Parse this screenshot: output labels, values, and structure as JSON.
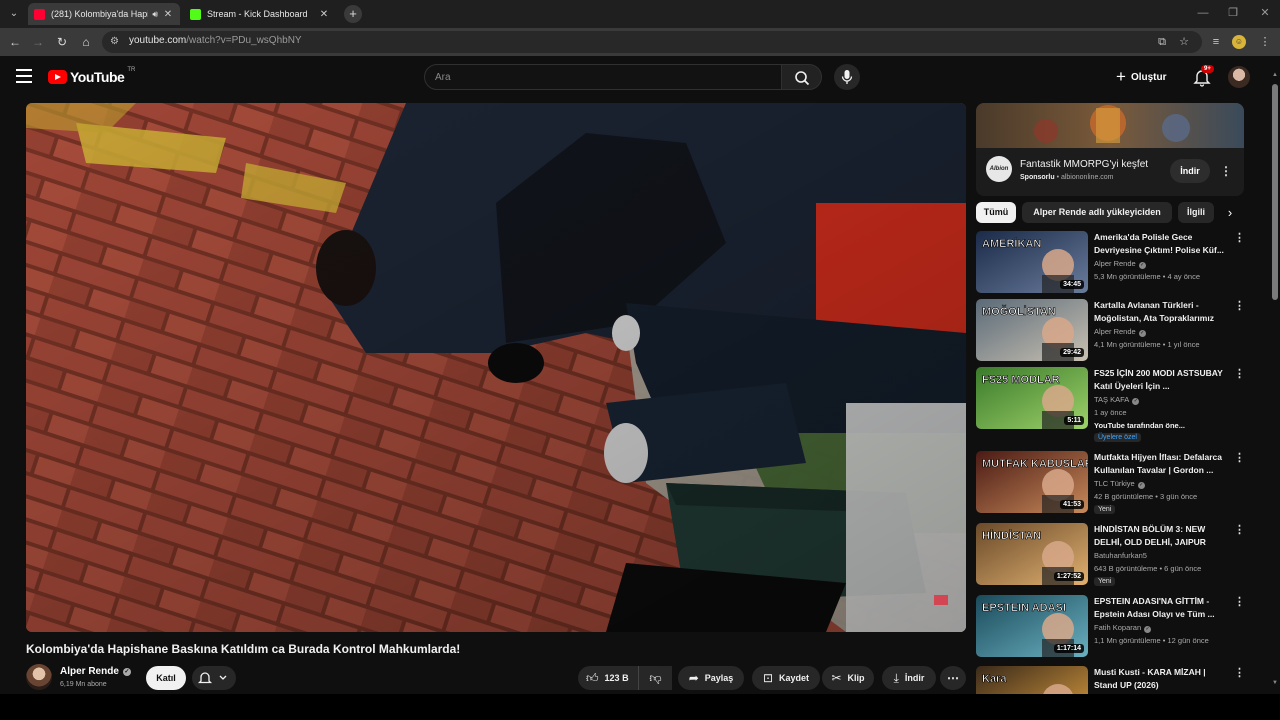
{
  "browser": {
    "tabs": [
      {
        "title": "(281) Kolombiya'da Hapish",
        "favicon_color": "#ff0033",
        "active": true,
        "audio_icon": "speaker-icon"
      },
      {
        "title": "Stream - Kick Dashboard",
        "favicon_color": "#53fc18",
        "active": false
      }
    ],
    "url_host": "youtube.com",
    "url_path": "/watch?v=PDu_wsQhbNY"
  },
  "youtube": {
    "logo_text": "YouTube",
    "country_code": "TR",
    "search_placeholder": "Ara",
    "create_label": "Oluştur",
    "notification_count": "9+"
  },
  "video": {
    "title": "Kolombiya'da Hapishane Baskına Katıldım ca Burada Kontrol Mahkumlarda!",
    "channel": "Alper Rende",
    "subscribers": "6,19 Mn abone",
    "join_label": "Katıl",
    "like_count": "123 B",
    "share_label": "Paylaş",
    "save_label": "Kaydet",
    "clip_label": "Klip",
    "download_label": "İndir"
  },
  "ad": {
    "title": "Fantastik MMORPG'yi keşfet",
    "sponsored": "Sponsorlu",
    "domain": "albiononline.com",
    "cta": "İndir",
    "logo_text": "Albion"
  },
  "chips": [
    "Tümü",
    "Alper Rende adlı yükleyiciden",
    "İlgili"
  ],
  "recommendations": [
    {
      "title": "Amerika'da Polisle Gece Devriyesine Çıktım! Polise Küf...",
      "channel": "Alper Rende",
      "verified": true,
      "meta": "5,3 Mn görüntüleme • 4 ay önce",
      "duration": "34:45",
      "tag": "",
      "thumb_text": "AMERİKAN",
      "c1": "#1a2a48",
      "c2": "#6a7c9c"
    },
    {
      "title": "Kartalla Avlanan Türkleri - Moğolistan, Ata Topraklarımız",
      "channel": "Alper Rende",
      "verified": true,
      "meta": "4,1 Mn görüntüleme • 1 yıl önce",
      "duration": "29:42",
      "tag": "",
      "thumb_text": "MOĞOLİSTAN",
      "c1": "#5a6a78",
      "c2": "#c9c1b2"
    },
    {
      "title": "FS25 İÇİN 200 MODI ASTSUBAY Katıl Üyeleri İçin ...",
      "channel": "TAŞ KAFA",
      "verified": true,
      "meta": "1 ay önce",
      "meta2": "YouTube tarafından öne...",
      "duration": "5:11",
      "tag": "Üyelere özel",
      "thumb_text": "FS25 MODLAR",
      "c1": "#3a7a2a",
      "c2": "#9ed26a"
    },
    {
      "title": "Mutfakta Hijyen İflası: Defalarca Kullanılan Tavalar | Gordon ...",
      "channel": "TLC Türkiye",
      "verified": true,
      "meta": "42 B görüntüleme • 3 gün önce",
      "duration": "41:53",
      "tag": "Yeni",
      "thumb_text": "MUTFAK KABUSLARI",
      "c1": "#4a1a14",
      "c2": "#c88a5a"
    },
    {
      "title": "HİNDİSTAN BÖLÜM 3: NEW DELHİ, OLD DELHİ, JAIPUR",
      "channel": "Batuhanfurkan5",
      "verified": false,
      "meta": "643 B görüntüleme • 6 gün önce",
      "duration": "1:27:52",
      "tag": "Yeni",
      "thumb_text": "HİNDİSTAN",
      "c1": "#6a4a2a",
      "c2": "#e0b070"
    },
    {
      "title": "EPSTEIN ADASI'NA GİTTİM - Epstein Adası Olayı ve Tüm ...",
      "channel": "Fatih Koparan",
      "verified": true,
      "meta": "1,1 Mn görüntüleme • 12 gün önce",
      "duration": "1:17:14",
      "tag": "",
      "thumb_text": "EPSTEIN ADASI",
      "c1": "#1a4a5a",
      "c2": "#6ab0c0"
    },
    {
      "title": "Musti Kusti - KARA MİZAH | Stand UP (2026)",
      "channel": "",
      "verified": false,
      "meta": "",
      "duration": "",
      "tag": "",
      "thumb_text": "Kara",
      "c1": "#3a2a1a",
      "c2": "#e0a040"
    }
  ]
}
